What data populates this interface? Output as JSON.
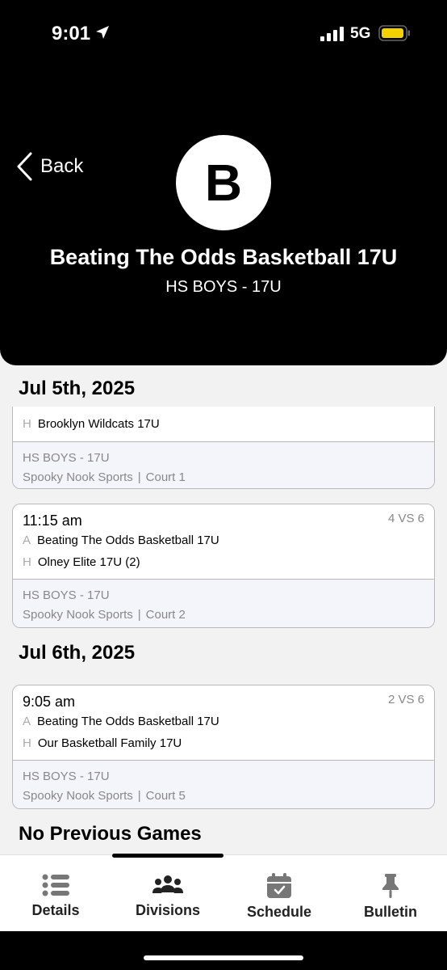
{
  "status_bar": {
    "time": "9:01",
    "network": "5G",
    "battery_color": "#f5d000"
  },
  "header": {
    "back_label": "Back",
    "avatar_letter": "B",
    "team_name": "Beating The Odds Basketball 17U",
    "division": "HS BOYS - 17U"
  },
  "days": [
    {
      "date": "Jul 5th, 2025",
      "games": [
        {
          "partial": true,
          "home_marker": "H",
          "home": "Brooklyn Wildcats 17U",
          "division": "HS BOYS - 17U",
          "venue": "Spooky Nook Sports",
          "separator": "|",
          "court": "Court 1"
        },
        {
          "time": "11:15 am",
          "matchup": "4 VS 6",
          "away_marker": "A",
          "away": "Beating The Odds Basketball 17U",
          "home_marker": "H",
          "home": "Olney Elite 17U (2)",
          "division": "HS BOYS - 17U",
          "venue": "Spooky Nook Sports",
          "separator": "|",
          "court": "Court 2"
        }
      ]
    },
    {
      "date": "Jul 6th, 2025",
      "games": [
        {
          "time": "9:05 am",
          "matchup": "2 VS 6",
          "away_marker": "A",
          "away": "Beating The Odds Basketball 17U",
          "home_marker": "H",
          "home": "Our Basketball Family 17U",
          "division": "HS BOYS - 17U",
          "venue": "Spooky Nook Sports",
          "separator": "|",
          "court": "Court 5"
        }
      ]
    }
  ],
  "previous_games_label": "No Previous Games",
  "tabs": [
    {
      "label": "Details",
      "icon": "list-icon"
    },
    {
      "label": "Divisions",
      "icon": "group-icon"
    },
    {
      "label": "Schedule",
      "icon": "calendar-icon"
    },
    {
      "label": "Bulletin",
      "icon": "pin-icon"
    }
  ]
}
